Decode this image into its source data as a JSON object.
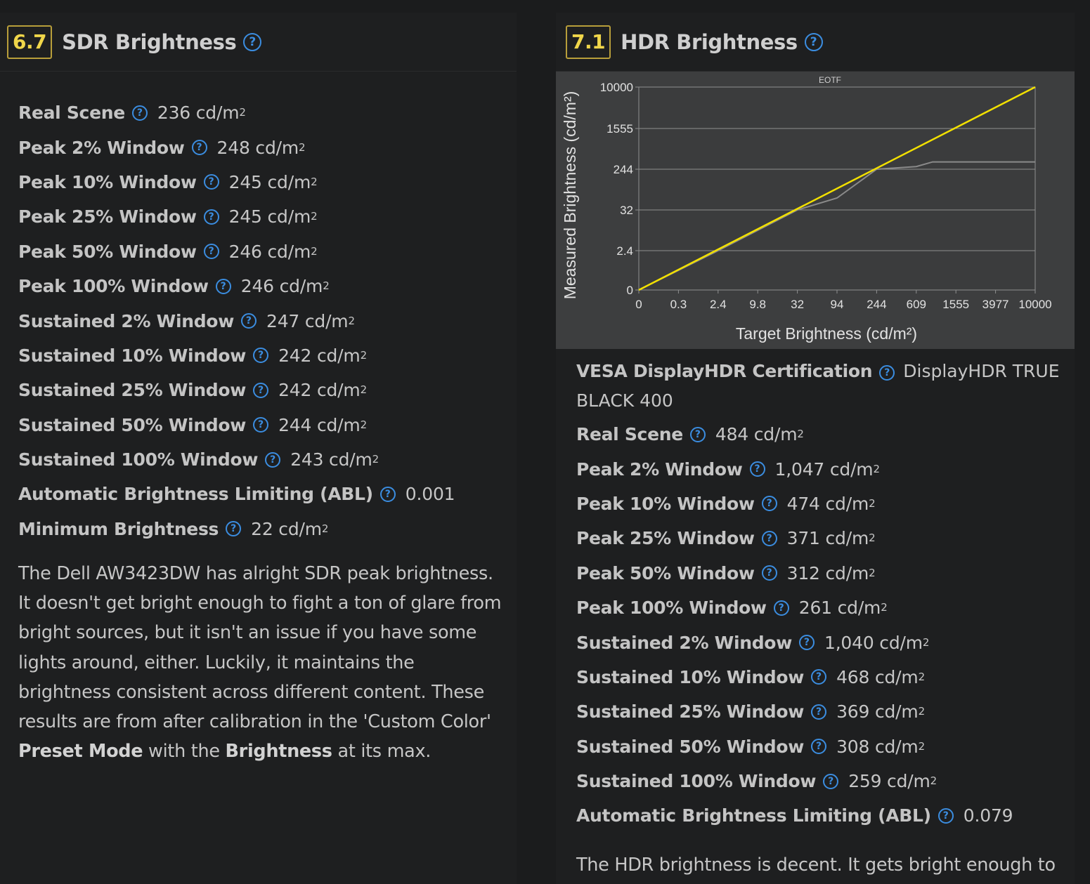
{
  "sdr": {
    "score": "6.7",
    "title": "SDR Brightness",
    "rows": [
      {
        "label": "Real Scene",
        "value": "236 cd/m",
        "sup": "2"
      },
      {
        "label": "Peak 2% Window",
        "value": "248 cd/m",
        "sup": "2"
      },
      {
        "label": "Peak 10% Window",
        "value": "245 cd/m",
        "sup": "2"
      },
      {
        "label": "Peak 25% Window",
        "value": "245 cd/m",
        "sup": "2"
      },
      {
        "label": "Peak 50% Window",
        "value": "246 cd/m",
        "sup": "2"
      },
      {
        "label": "Peak 100% Window",
        "value": "246 cd/m",
        "sup": "2"
      },
      {
        "label": "Sustained 2% Window",
        "value": "247 cd/m",
        "sup": "2"
      },
      {
        "label": "Sustained 10% Window",
        "value": "242 cd/m",
        "sup": "2"
      },
      {
        "label": "Sustained 25% Window",
        "value": "242 cd/m",
        "sup": "2"
      },
      {
        "label": "Sustained 50% Window",
        "value": "244 cd/m",
        "sup": "2"
      },
      {
        "label": "Sustained 100% Window",
        "value": "243 cd/m",
        "sup": "2"
      },
      {
        "label": "Automatic Brightness Limiting (ABL)",
        "value": "0.001",
        "sup": ""
      },
      {
        "label": "Minimum Brightness",
        "value": "22 cd/m",
        "sup": "2"
      }
    ],
    "paragraph": {
      "text_1": "The Dell AW3423DW has alright SDR peak brightness. It doesn't get bright enough to fight a ton of glare from bright sources, but it isn't an issue if you have some lights around, either. Luckily, it maintains the brightness consistent across different content. These results are from after calibration in the 'Custom Color' ",
      "bold_1": "Preset Mode",
      "text_2": " with the ",
      "bold_2": "Brightness",
      "text_3": " at its max."
    }
  },
  "hdr": {
    "score": "7.1",
    "title": "HDR Brightness",
    "certification": {
      "label": "VESA DisplayHDR Certification",
      "value": "DisplayHDR TRUE BLACK 400"
    },
    "rows": [
      {
        "label": "Real Scene",
        "value": "484 cd/m",
        "sup": "2"
      },
      {
        "label": "Peak 2% Window",
        "value": "1,047 cd/m",
        "sup": "2"
      },
      {
        "label": "Peak 10% Window",
        "value": "474 cd/m",
        "sup": "2"
      },
      {
        "label": "Peak 25% Window",
        "value": "371 cd/m",
        "sup": "2"
      },
      {
        "label": "Peak 50% Window",
        "value": "312 cd/m",
        "sup": "2"
      },
      {
        "label": "Peak 100% Window",
        "value": "261 cd/m",
        "sup": "2"
      },
      {
        "label": "Sustained 2% Window",
        "value": "1,040 cd/m",
        "sup": "2"
      },
      {
        "label": "Sustained 10% Window",
        "value": "468 cd/m",
        "sup": "2"
      },
      {
        "label": "Sustained 25% Window",
        "value": "369 cd/m",
        "sup": "2"
      },
      {
        "label": "Sustained 50% Window",
        "value": "308 cd/m",
        "sup": "2"
      },
      {
        "label": "Sustained 100% Window",
        "value": "259 cd/m",
        "sup": "2"
      },
      {
        "label": "Automatic Brightness Limiting (ABL)",
        "value": "0.079",
        "sup": ""
      }
    ],
    "paragraph_start": "The HDR brightness is decent. It gets bright enough to"
  },
  "icons": {
    "help": "question-circle-icon",
    "help_glyph": "?"
  },
  "colors": {
    "score_border": "#b89e3a",
    "score_text": "#f0d64a",
    "help_icon": "#3b8de0",
    "target_line": "#f2e000",
    "measured_line": "#8a8a8a"
  },
  "chart_data": {
    "type": "line",
    "title": "EOTF",
    "xlabel": "Target Brightness (cd/m²)",
    "ylabel": "Measured Brightness (cd/m²)",
    "x_ticks": [
      "0",
      "0.3",
      "2.4",
      "9.8",
      "32",
      "94",
      "244",
      "609",
      "1555",
      "3977",
      "10000"
    ],
    "y_ticks": [
      "0",
      "2.4",
      "32",
      "244",
      "1555",
      "10000"
    ],
    "x_tick_values": [
      0,
      0.3,
      2.4,
      9.8,
      32,
      94,
      244,
      609,
      1555,
      3977,
      10000
    ],
    "y_tick_values": [
      0,
      2.4,
      32,
      244,
      1555,
      10000
    ],
    "grid": true,
    "series": [
      {
        "color": "#f2e000",
        "x": [
          0,
          10000
        ],
        "y": [
          0,
          10000
        ]
      },
      {
        "color": "#8a8a8a",
        "x": [
          0,
          2.4,
          32,
          94,
          244,
          609,
          1000,
          1555,
          3977,
          10000
        ],
        "y": [
          0,
          2.4,
          32,
          94,
          244,
          330,
          480,
          480,
          480,
          480
        ]
      }
    ]
  }
}
